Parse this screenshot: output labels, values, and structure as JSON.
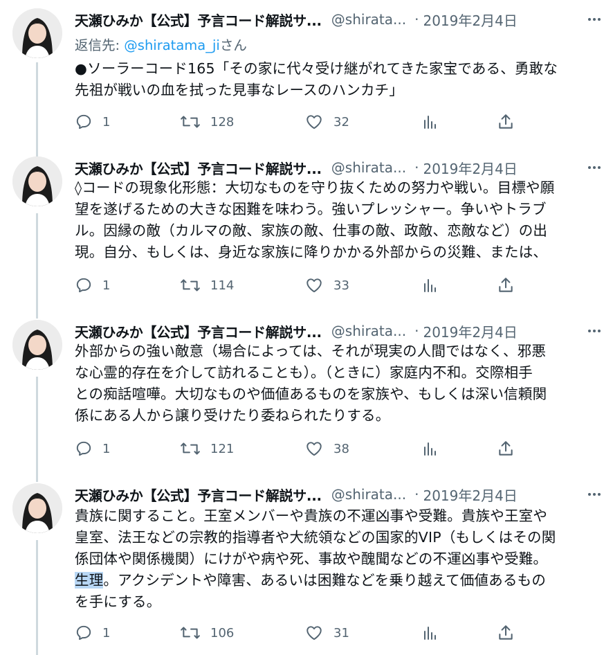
{
  "tweets": [
    {
      "name": "天瀬ひみか【公式】予言コード解説サ...",
      "handle": "@shirata...",
      "separator": "·",
      "date": "2019年2月4日",
      "reply_prefix": "返信先: ",
      "reply_mention": "@shiratama_ji",
      "reply_suffix": "さん",
      "lines": [
        "●ソーラーコード165「その家に代々受け継がれてきた家宝である、勇敢な",
        "先祖が戦いの血を拭った見事なレースのハンカチ」"
      ],
      "replies": "1",
      "retweets": "128",
      "likes": "32"
    },
    {
      "name": "天瀬ひみか【公式】予言コード解説サ...",
      "handle": "@shirata...",
      "separator": "·",
      "date": "2019年2月4日",
      "lines": [
        "◊コードの現象化形態：大切なものを守り抜くための努力や戦い。目標や願",
        "望を遂げるための大きな困難を味わう。強いプレッシャー。争いやトラブ",
        "ル。因縁の敵（カルマの敵、家族の敵、仕事の敵、政敵、恋敵など）の出",
        "現。自分、もしくは、身近な家族に降りかかる外部からの災難、または、"
      ],
      "replies": "1",
      "retweets": "114",
      "likes": "33"
    },
    {
      "name": "天瀬ひみか【公式】予言コード解説サ...",
      "handle": "@shirata...",
      "separator": "·",
      "date": "2019年2月4日",
      "lines": [
        "外部からの強い敵意（場合によっては、それが現実の人間ではなく、邪悪",
        "な心霊的存在を介して訪れることも）。（ときに）家庭内不和。交際相手",
        "との痴話喧嘩。大切なものや価値あるものを家族や、もしくは深い信頼関",
        "係にある人から譲り受けたり委ねられたりする。"
      ],
      "replies": "1",
      "retweets": "121",
      "likes": "38"
    },
    {
      "name": "天瀬ひみか【公式】予言コード解説サ...",
      "handle": "@shirata...",
      "separator": "·",
      "date": "2019年2月4日",
      "lines": [
        "貴族に関すること。王室メンバーや貴族の不運凶事や受難。貴族や王室や",
        "皇室、法王などの宗教的指導者や大統領などの国家的VIP（もしくはその関",
        "係団体や関係機関）にけがや病や死、事故や醜聞などの不運凶事や受難。",
        "",
        "を手にする。"
      ],
      "highlight_text": "生理",
      "line4_rest": "。アクシデントや障害、あるいは困難などを乗り越えて価値あるもの",
      "replies": "1",
      "retweets": "106",
      "likes": "31"
    }
  ],
  "icons": {
    "more": "more-horizontal-icon",
    "reply": "reply-icon",
    "retweet": "retweet-icon",
    "like": "heart-icon",
    "analytics": "analytics-icon",
    "share": "share-icon"
  },
  "colors": {
    "text": "#0f1419",
    "muted": "#536471",
    "link": "#1d9bf0",
    "thread_line": "#cfd9de",
    "highlight": "#b8d7f5"
  }
}
